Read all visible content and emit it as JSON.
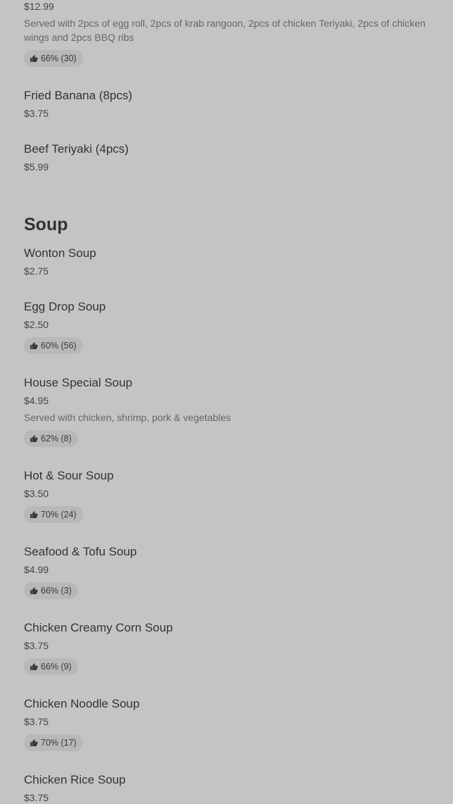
{
  "partial_item": {
    "price": "$12.99",
    "description": "Served with 2pcs of egg roll, 2pcs of krab rangoon, 2pcs of chicken Teriyaki, 2pcs of chicken wings and 2pcs BBQ ribs",
    "rating": "66% (30)"
  },
  "items_top": [
    {
      "name": "Fried Banana (8pcs)",
      "price": "$3.75"
    },
    {
      "name": "Beef Teriyaki (4pcs)",
      "price": "$5.99"
    }
  ],
  "soup_section": {
    "title": "Soup",
    "items": [
      {
        "name": "Wonton Soup",
        "price": "$2.75"
      },
      {
        "name": "Egg Drop Soup",
        "price": "$2.50",
        "rating": "60% (56)"
      },
      {
        "name": "House Special Soup",
        "price": "$4.95",
        "description": "Served with chicken, shrimp, pork & vegetables",
        "rating": "62% (8)"
      },
      {
        "name": "Hot & Sour Soup",
        "price": "$3.50",
        "rating": "70% (24)"
      },
      {
        "name": "Seafood & Tofu Soup",
        "price": "$4.99",
        "rating": "66% (3)"
      },
      {
        "name": "Chicken Creamy Corn Soup",
        "price": "$3.75",
        "rating": "66% (9)"
      },
      {
        "name": "Chicken Noodle Soup",
        "price": "$3.75",
        "rating": "70% (17)"
      },
      {
        "name": "Chicken Rice Soup",
        "price": "$3.75"
      }
    ]
  },
  "icons": {
    "rating": "thumbs-up-icon"
  }
}
